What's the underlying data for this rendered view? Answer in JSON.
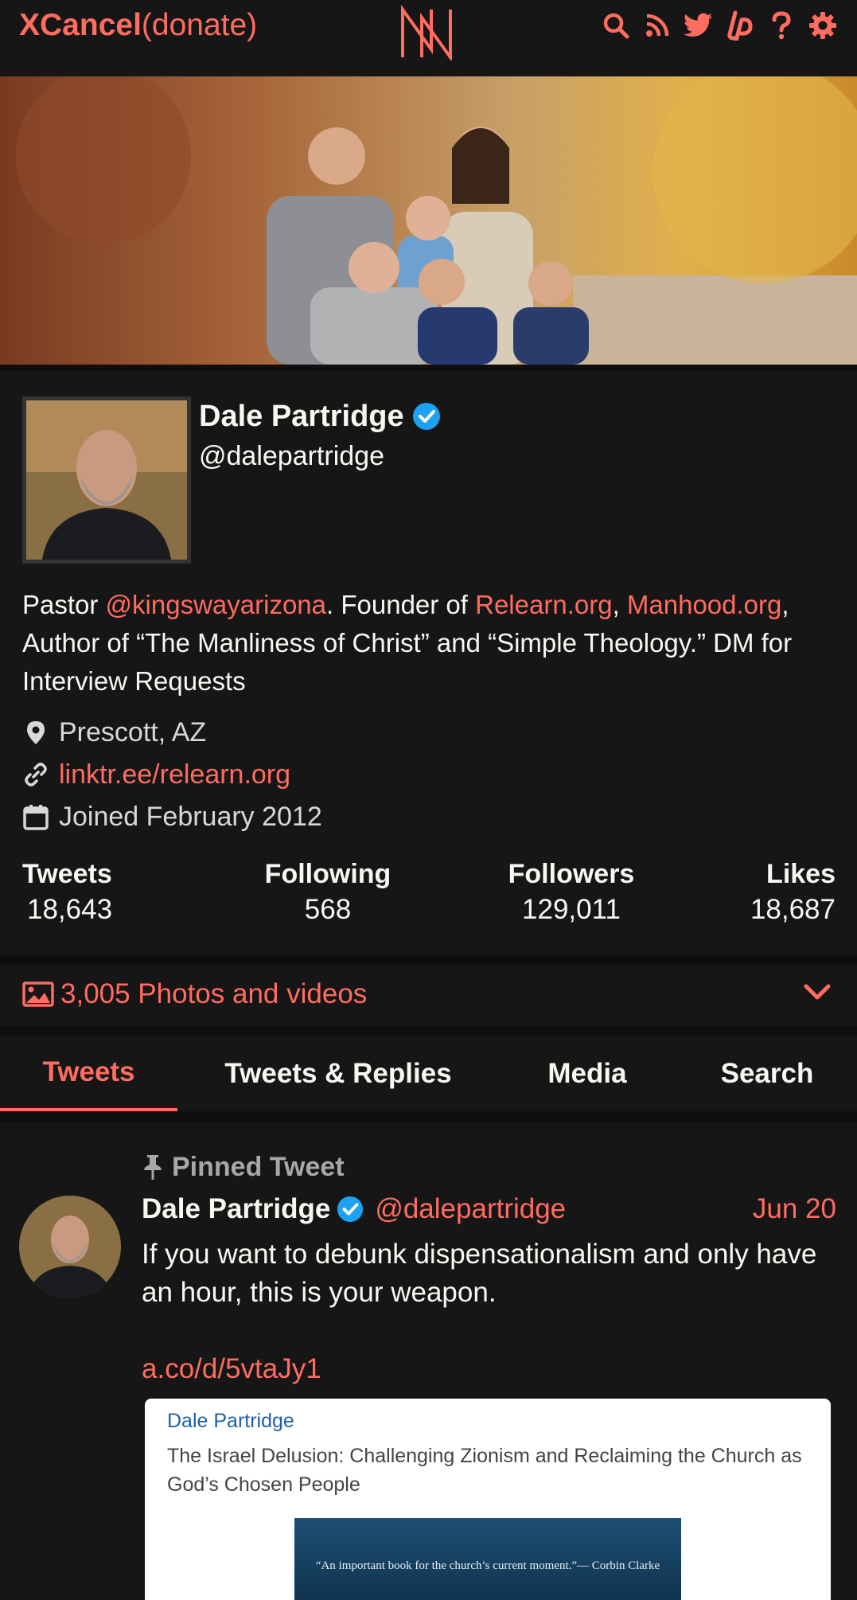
{
  "nav": {
    "brand_bold": "XCancel",
    "brand_rest": "(donate)",
    "icons": [
      "search-icon",
      "rss-icon",
      "twitter-icon",
      "liberapay-icon",
      "help-icon",
      "gear-icon"
    ]
  },
  "profile": {
    "name": "Dale Partridge",
    "handle": "@dalepartridge",
    "bio": {
      "t1": "Pastor ",
      "l1": "@kingswayarizona",
      "t2": ". Founder of ",
      "l2": "Relearn.org",
      "t3": ", ",
      "l3": "Manhood.org",
      "t4": ", Author of “The Manliness of Christ” and “Simple Theology.” DM for Interview Requests"
    },
    "location": "Prescott, AZ",
    "website": "linktr.ee/relearn.org",
    "joined": "Joined February 2012",
    "stats": {
      "tweets_label": "Tweets",
      "tweets": "18,643",
      "following_label": "Following",
      "following": "568",
      "followers_label": "Followers",
      "followers": "129,011",
      "likes_label": "Likes",
      "likes": "18,687"
    }
  },
  "photos": {
    "label": "3,005 Photos and videos"
  },
  "tabs": [
    {
      "label": "Tweets",
      "active": true
    },
    {
      "label": "Tweets & Replies"
    },
    {
      "label": "Media"
    },
    {
      "label": "Search"
    }
  ],
  "tweet": {
    "pinned_label": "Pinned Tweet",
    "name": "Dale Partridge",
    "handle": "@dalepartridge",
    "date": "Jun 20",
    "text": "If you want to debunk dispensationalism and only have an hour, this is your weapon.",
    "link": "a.co/d/5vtaJy1",
    "card": {
      "author": "Dale Partridge",
      "title": "The Israel Delusion: Challenging Zionism and Reclaiming the Church as God’s Chosen People",
      "cover_quote": "“An important book for the church’s current moment.”— Corbin Clarke"
    }
  },
  "colors": {
    "accent": "#ff6c60",
    "verified": "#1da1f2",
    "background": "#0f0f0f",
    "panel": "#161616"
  }
}
